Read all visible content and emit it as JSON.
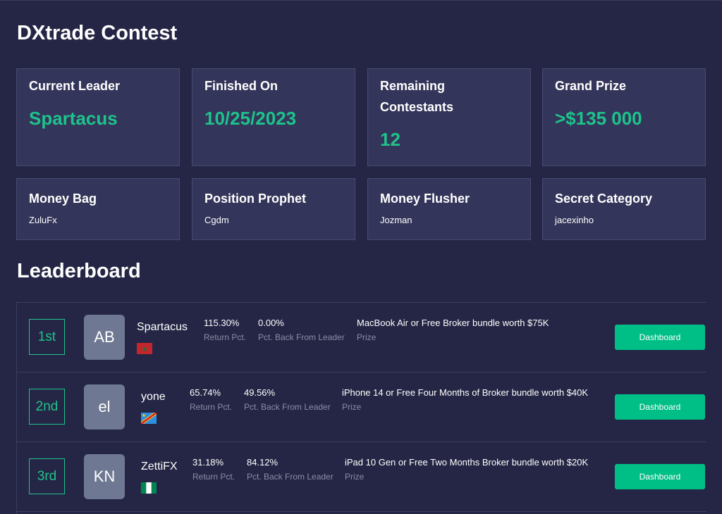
{
  "page": {
    "title": "DXtrade Contest"
  },
  "stats": [
    {
      "label": "Current Leader",
      "value": "Spartacus"
    },
    {
      "label": "Finished On",
      "value": "10/25/2023"
    },
    {
      "label": "Remaining Contestants",
      "label_line1": "Remaining",
      "label_line2": "Contestants",
      "value": "12"
    },
    {
      "label": "Grand Prize",
      "value": ">$135 000"
    }
  ],
  "awards": [
    {
      "label": "Money Bag",
      "winner": "ZuluFx"
    },
    {
      "label": "Position Prophet",
      "winner": "Cgdm"
    },
    {
      "label": "Money Flusher",
      "winner": "Jozman"
    },
    {
      "label": "Secret Category",
      "winner": "jacexinho"
    }
  ],
  "leaderboard": {
    "title": "Leaderboard",
    "return_label": "Return Pct.",
    "back_label": "Pct. Back From Leader",
    "prize_label": "Prize",
    "button_label": "Dashboard",
    "rows": [
      {
        "rank": "1st",
        "initials": "AB",
        "name": "Spartacus",
        "country": "Morocco",
        "flag_icon": "morocco-flag-icon",
        "return_pct": "115.30%",
        "back_pct": "0.00%",
        "prize": "MacBook Air or Free Broker bundle worth $75K"
      },
      {
        "rank": "2nd",
        "initials": "el",
        "name": "yone",
        "country": "DR Congo",
        "flag_icon": "dr-congo-flag-icon",
        "return_pct": "65.74%",
        "back_pct": "49.56%",
        "prize": "iPhone 14 or Free Four Months of Broker bundle worth $40K"
      },
      {
        "rank": "3rd",
        "initials": "KN",
        "name": "ZettiFX",
        "country": "Nigeria",
        "flag_icon": "nigeria-flag-icon",
        "return_pct": "31.18%",
        "back_pct": "84.12%",
        "prize": "iPad 10 Gen or Free Two Months Broker bundle worth $20K"
      }
    ]
  },
  "colors": {
    "accent": "#1ec38b",
    "button": "#00bf86",
    "background": "#252645",
    "card": "#34355a",
    "muted": "#8a8ca6"
  }
}
